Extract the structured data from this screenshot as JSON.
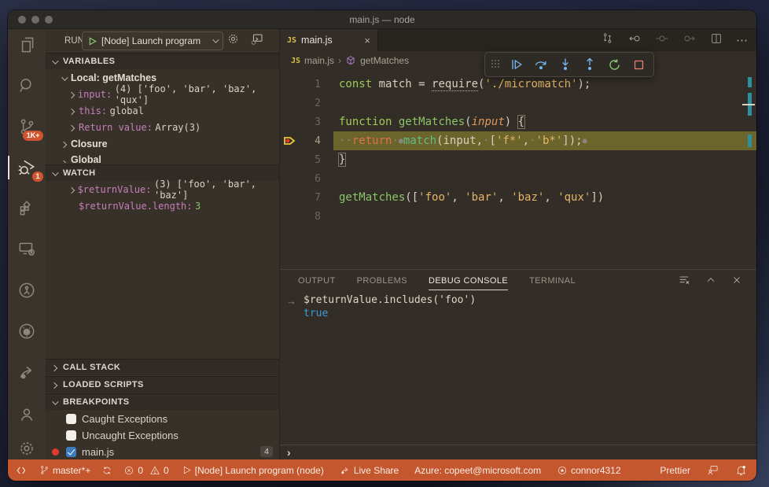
{
  "window": {
    "title": "main.js — node"
  },
  "activity_bar": {
    "scm_badge": "1K+",
    "debug_badge": "1"
  },
  "run_bar": {
    "label": "RUN",
    "config": "[Node] Launch program"
  },
  "sidebar": {
    "variables_header": "VARIABLES",
    "scope_local": "Local: getMatches",
    "var_input_name": "input:",
    "var_input_value": "(4) ['foo', 'bar', 'baz', 'qux']",
    "var_this_name": "this:",
    "var_this_value": "global",
    "var_return_name": "Return value:",
    "var_return_value": "Array(3)",
    "scope_closure": "Closure",
    "scope_global": "Global",
    "watch_header": "WATCH",
    "watch1_name": "$returnValue:",
    "watch1_value": "(3) ['foo', 'bar', 'baz']",
    "watch2_name": "$returnValue.length:",
    "watch2_value": "3",
    "call_stack_header": "CALL STACK",
    "loaded_scripts_header": "LOADED SCRIPTS",
    "breakpoints_header": "BREAKPOINTS",
    "bp_caught": "Caught Exceptions",
    "bp_uncaught": "Uncaught Exceptions",
    "bp_file": "main.js",
    "bp_file_count": "4"
  },
  "editor": {
    "tab_label": "main.js",
    "tab_close": "×",
    "breadcrumb_file": "main.js",
    "breadcrumb_symbol": "getMatches",
    "lines": {
      "n1": "1",
      "n2": "2",
      "n3": "3",
      "n4": "4",
      "n5": "5",
      "n6": "6",
      "n7": "7",
      "n8": "8"
    },
    "code": {
      "l1": {
        "kw": "const",
        "v1": " match ",
        "op": "= ",
        "req": "require",
        "p1": "(",
        "s1": "'./micromatch'",
        "p2": ");"
      },
      "l3": {
        "kw": "function",
        "sp": " ",
        "fn": "getMatches",
        "p1": "(",
        "param": "input",
        "p2": ") ",
        "br": "{"
      },
      "l4": {
        "ws": "··",
        "kw": "return",
        "d1": "·",
        "dot1": "●",
        "fn": "match",
        "p1": "(input,",
        "d2": "·",
        "lb": "[",
        "s1": "'f*'",
        "c1": ",",
        "d3": "·",
        "s2": "'b*'",
        "rb": "]);",
        "dot2": "●"
      },
      "l5": {
        "br": "}"
      },
      "l7": {
        "fn": "getMatches",
        "p1": "([",
        "s1": "'foo'",
        "c1": ", ",
        "s2": "'bar'",
        "c2": ", ",
        "s3": "'baz'",
        "c3": ", ",
        "s4": "'qux'",
        "p2": "])"
      }
    }
  },
  "panel": {
    "tab_output": "OUTPUT",
    "tab_problems": "PROBLEMS",
    "tab_debug": "DEBUG CONSOLE",
    "tab_terminal": "TERMINAL",
    "expression": "$returnValue.includes('foo')",
    "result": "true",
    "prompt": "›",
    "arrow": "→"
  },
  "status_bar": {
    "branch": "master*+",
    "errors": "0",
    "warnings": "0",
    "launch": "[Node] Launch program (node)",
    "live_share": "Live Share",
    "azure": "Azure: copeet@microsoft.com",
    "account": "connor4312",
    "formatter": "Prettier"
  }
}
